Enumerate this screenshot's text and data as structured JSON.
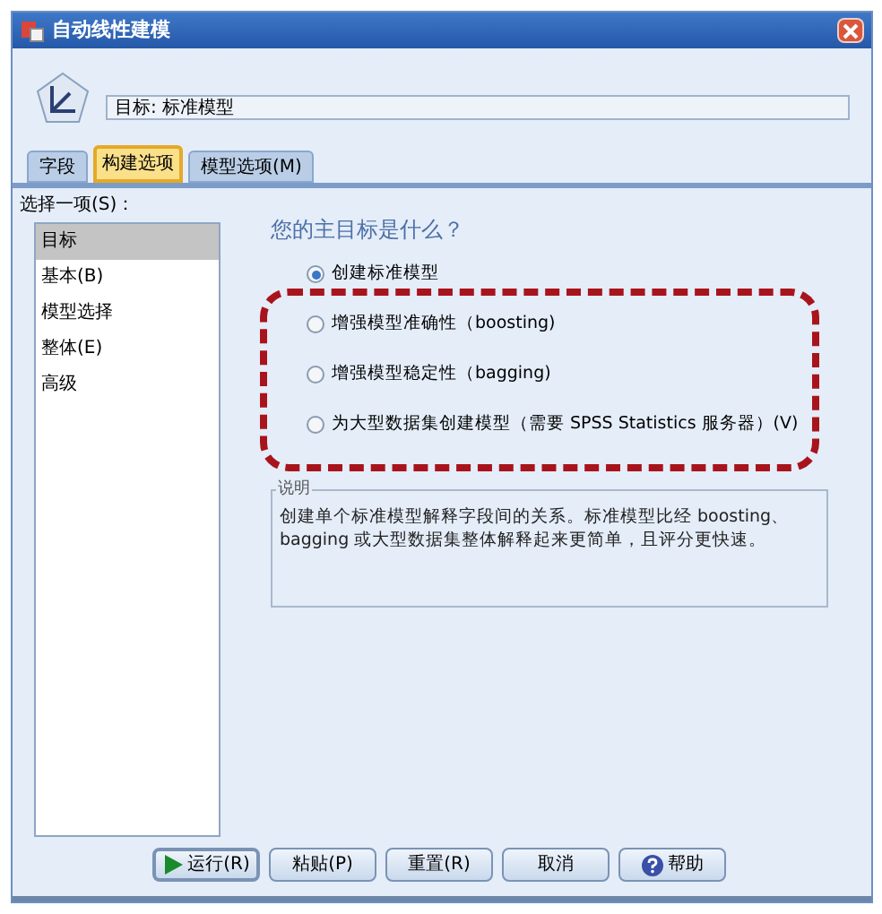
{
  "window": {
    "title": "自动线性建模"
  },
  "target": {
    "value": "目标: 标准模型"
  },
  "tabs": [
    {
      "label": "字段",
      "selected": false
    },
    {
      "label": "构建选项",
      "selected": true
    },
    {
      "label": "模型选项(M)",
      "selected": false
    }
  ],
  "list_label": "选择一项(S)：",
  "list_items": [
    {
      "label": "目标",
      "selected": true
    },
    {
      "label": "基本(B)",
      "selected": false
    },
    {
      "label": "模型选择",
      "selected": false
    },
    {
      "label": "整体(E)",
      "selected": false
    },
    {
      "label": "高级",
      "selected": false
    }
  ],
  "question": "您的主目标是什么？",
  "options": [
    {
      "label": "创建标准模型",
      "selected": true
    },
    {
      "label": "增强模型准确性（boosting)",
      "selected": false
    },
    {
      "label": "增强模型稳定性（bagging)",
      "selected": false
    },
    {
      "label": "为大型数据集创建模型（需要 SPSS Statistics 服务器）(V)",
      "selected": false
    }
  ],
  "description": {
    "title": "说明",
    "text": "创建单个标准模型解释字段间的关系。标准模型比经 boosting、bagging 或大型数据集整体解释起来更简单，且评分更快速。"
  },
  "buttons": [
    {
      "kind": "run",
      "label": "运行(R)"
    },
    {
      "kind": "plain",
      "label": "粘贴(P)"
    },
    {
      "kind": "plain",
      "label": "重置(R)"
    },
    {
      "kind": "plain",
      "label": "取消"
    },
    {
      "kind": "help",
      "label": "帮助"
    }
  ]
}
